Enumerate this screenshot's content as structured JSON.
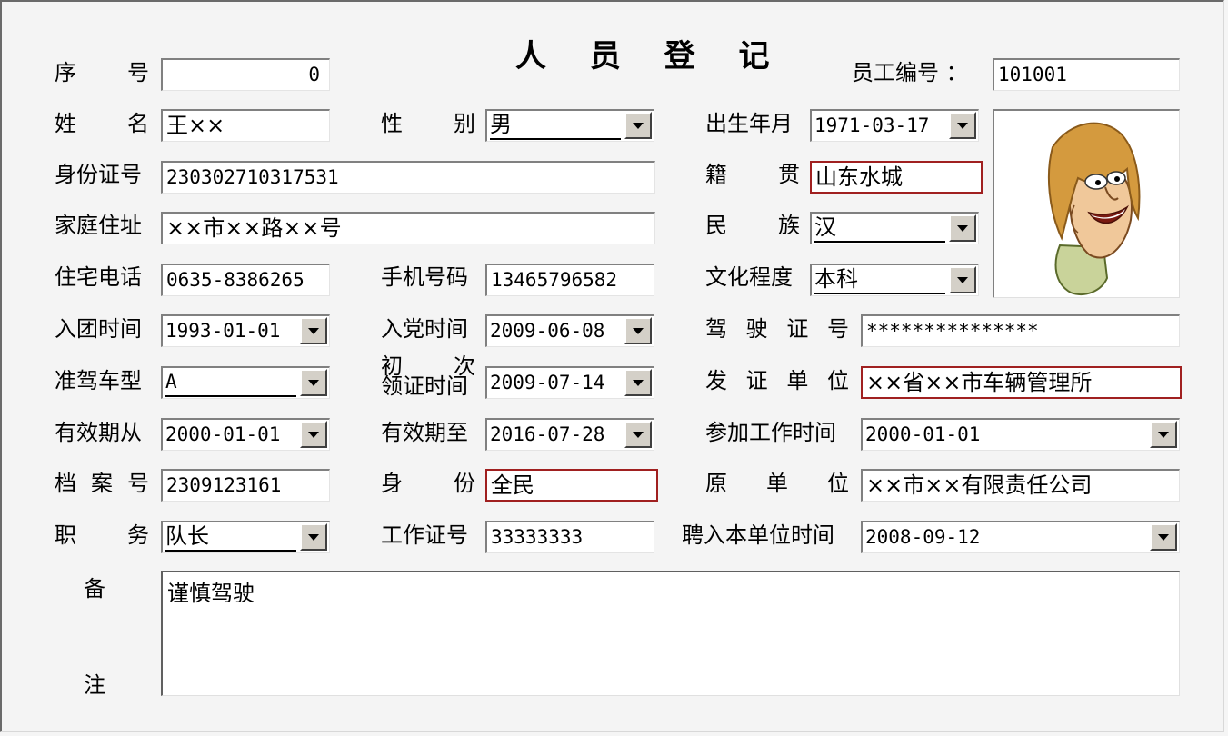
{
  "title": "人 员 登 记",
  "labels": {
    "seq_a": "序",
    "seq_b": "号",
    "emp_no": "员工编号 ：",
    "name_a": "姓",
    "name_b": "名",
    "gender_a": "性",
    "gender_b": "别",
    "birth": "出生年月",
    "id_card": "身份证号",
    "native_a": "籍",
    "native_b": "贯",
    "address": "家庭住址",
    "ethnic_a": "民",
    "ethnic_b": "族",
    "home_phone": "住宅电话",
    "mobile": "手机号码",
    "education": "文化程度",
    "league_date": "入团时间",
    "party_date": "入党时间",
    "license_no": [
      "驾",
      "驶",
      "证",
      "号"
    ],
    "vehicle_type": "准驾车型",
    "first_license_a": "初",
    "first_license_b": "次",
    "first_license_c": "领证时间",
    "issuer": [
      "发",
      "证",
      "单",
      "位"
    ],
    "valid_from": "有效期从",
    "valid_to": "有效期至",
    "work_start": "参加工作时间",
    "archive": [
      "档",
      "案",
      "号"
    ],
    "identity_a": "身",
    "identity_b": "份",
    "former_unit": [
      "原",
      "单",
      "位"
    ],
    "duty_a": "职",
    "duty_b": "务",
    "work_card": "工作证号",
    "hire_date": "聘入本单位时间",
    "remark_a": "备",
    "remark_b": "注"
  },
  "values": {
    "seq": "0",
    "emp_no": "101001",
    "name": "王××",
    "gender": "男",
    "birth": "1971-03-17",
    "id_card": "230302710317531",
    "native": "山东水城",
    "address": "××市××路××号",
    "ethnic": "汉",
    "home_phone": "0635-8386265",
    "mobile": "13465796582",
    "education": "本科",
    "league_date": "1993-01-01",
    "party_date": "2009-06-08",
    "license_no": "***************",
    "vehicle_type": "A",
    "first_license": "2009-07-14",
    "issuer": "××省××市车辆管理所",
    "valid_from": "2000-01-01",
    "valid_to": "2016-07-28",
    "work_start": "2000-01-01",
    "archive": "2309123161",
    "identity": "全民",
    "former_unit": "××市××有限责任公司",
    "duty": "队长",
    "work_card": "33333333",
    "hire_date": "2008-09-12",
    "remark": "谨慎驾驶"
  },
  "icons": {
    "dropdown": "chevron-down-icon",
    "photo": "cartoon-portrait"
  }
}
